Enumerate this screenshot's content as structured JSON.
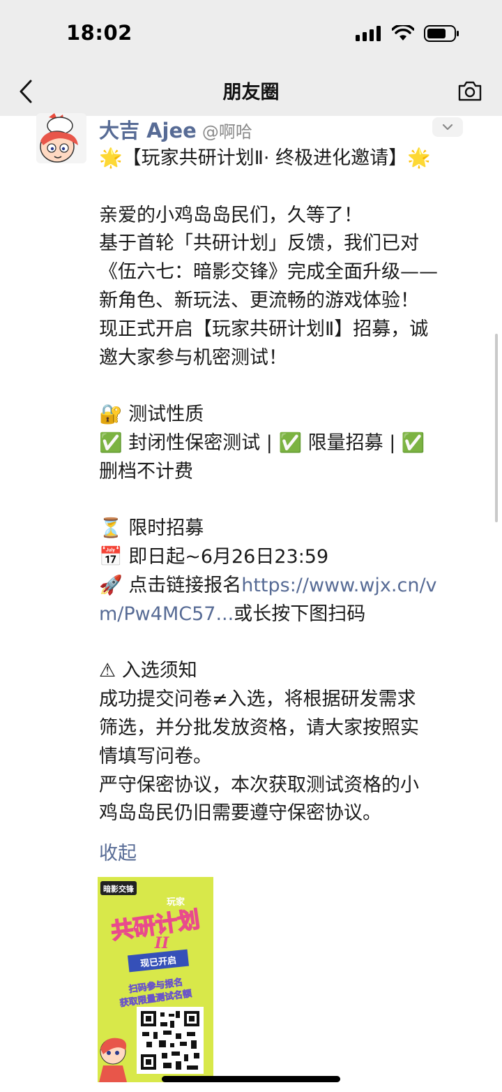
{
  "status_bar": {
    "time": "18:02"
  },
  "nav": {
    "title": "朋友圈"
  },
  "post": {
    "author": "大吉 Ajee",
    "mention": "@啊哈",
    "lines": [
      "🌟【玩家共研计划Ⅱ· 终极进化邀请】🌟",
      "",
      "亲爱的小鸡岛岛民们，久等了！",
      "基于首轮「共研计划」反馈，我们已对",
      "《伍六七：暗影交锋》完成全面升级——",
      "新角色、新玩法、更流畅的游戏体验！",
      "现正式开启【玩家共研计划Ⅱ】招募，诚",
      "邀大家参与机密测试！",
      "",
      "🔐 测试性质",
      "✅ 封闭性保密测试 | ✅ 限量招募 | ✅",
      "删档不计费",
      "",
      "⏳ 限时招募",
      "📅 即日起~6月26日23:59",
      "🚀 点击链接报名"
    ],
    "link_part1": "https://www.wjx.cn/v",
    "link_part2": "m/Pw4MC57...",
    "after_link": "或长按下图扫码",
    "lines2": [
      "",
      "⚠ 入选须知",
      "成功提交问卷≠入选，将根据研发需求",
      "筛选，并分批发放资格，请大家按照实",
      "情填写问卷。",
      "严守保密协议，本次获取测试资格的小",
      "鸡岛岛民仍旧需要遵守保密协议。"
    ],
    "collapse_label": "收起",
    "poster": {
      "logo": "暗影交锋",
      "small": "玩家",
      "big": "共研计划",
      "roman": "II",
      "banner": "现已开启",
      "cta1": "扫码参与报名",
      "cta2": "获取限量测试名额"
    }
  },
  "colors": {
    "link": "#576b95",
    "bar_bg": "#ededed",
    "poster_bg": "#d8e84a"
  }
}
